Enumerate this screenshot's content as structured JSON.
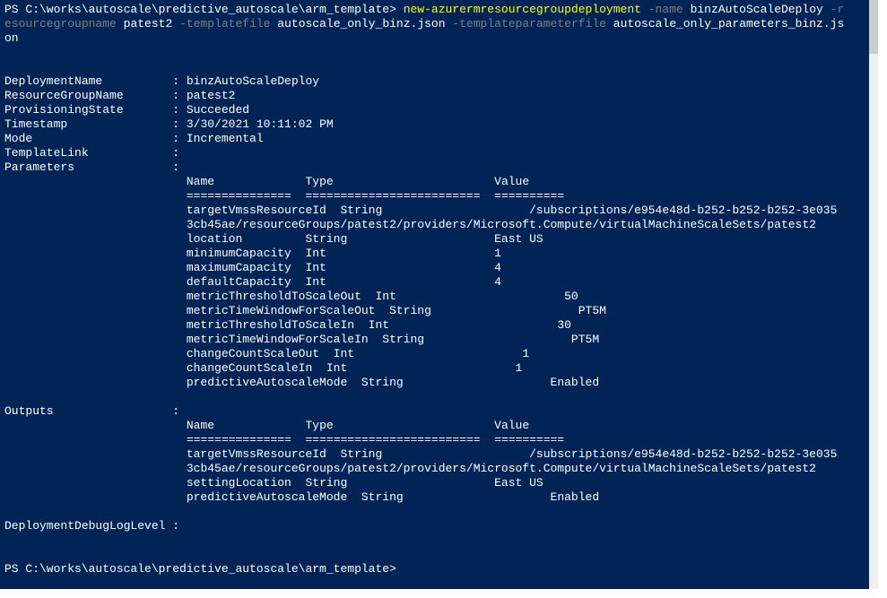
{
  "path": "C:\\works\\autoscale\\predictive_autoscale\\arm_template",
  "cmd": {
    "name": "new-azurermresourcegroupdeployment",
    "p_name": "-name",
    "v_name": "binzAutoScaleDeploy",
    "p_rg": "-r",
    "p_rg2": "esourcegroupname",
    "v_rg": "patest2",
    "p_tf": "-templatefile",
    "v_tf": "autoscale_only_binz.json",
    "p_tpf": "-templateparameterfile",
    "v_tpf": "autoscale_only_parameters_binz.js",
    "v_tpf2": "on"
  },
  "dep": {
    "DeploymentName": "binzAutoScaleDeploy",
    "ResourceGroupName": "patest2",
    "ProvisioningState": "Succeeded",
    "Timestamp": "3/30/2021 10:11:02 PM",
    "Mode": "Incremental",
    "TemplateLink": "",
    "ParametersLabel": "Parameters",
    "OutputsLabel": "Outputs",
    "DebugLabel": "DeploymentDebugLogLevel"
  },
  "hdr": {
    "name": "Name",
    "type": "Type",
    "value": "Value",
    "d1": "===============",
    "d2": "=========================",
    "d3": "=========="
  },
  "params": {
    "targetVmssResourceId": {
      "type": "String",
      "value": "/subscriptions/e954e48d-b252-b252-b252-3e035"
    },
    "targetLine2": "3cb45ae/resourceGroups/patest2/providers/Microsoft.Compute/virtualMachineScaleSets/patest2",
    "location": {
      "type": "String",
      "value": "East US"
    },
    "minimumCapacity": {
      "type": "Int",
      "value": "1"
    },
    "maximumCapacity": {
      "type": "Int",
      "value": "4"
    },
    "defaultCapacity": {
      "type": "Int",
      "value": "4"
    },
    "metricThresholdToScaleOut": {
      "type": "Int",
      "value": "50"
    },
    "metricTimeWindowForScaleOut": {
      "type": "String",
      "value": "PT5M"
    },
    "metricThresholdToScaleIn": {
      "type": "Int",
      "value": "30"
    },
    "metricTimeWindowForScaleIn": {
      "type": "String",
      "value": "PT5M"
    },
    "changeCountScaleOut": {
      "type": "Int",
      "value": "1"
    },
    "changeCountScaleIn": {
      "type": "Int",
      "value": "1"
    },
    "predictiveAutoscaleMode": {
      "type": "String",
      "value": "Enabled"
    }
  },
  "outputs": {
    "targetVmssResourceId": {
      "type": "String",
      "value": "/subscriptions/e954e48d-b252-b252-b252-3e035"
    },
    "targetLine2": "3cb45ae/resourceGroups/patest2/providers/Microsoft.Compute/virtualMachineScaleSets/patest2",
    "settingLocation": {
      "type": "String",
      "value": "East US"
    },
    "predictiveAutoscaleMode": {
      "type": "String",
      "value": "Enabled"
    }
  },
  "chart_data": {
    "type": "table",
    "title": "ARM Deployment Parameters",
    "columns": [
      "Name",
      "Type",
      "Value"
    ],
    "rows": [
      [
        "targetVmssResourceId",
        "String",
        "/subscriptions/e954e48d-b252-b252-b252-3e0353cb45ae/resourceGroups/patest2/providers/Microsoft.Compute/virtualMachineScaleSets/patest2"
      ],
      [
        "location",
        "String",
        "East US"
      ],
      [
        "minimumCapacity",
        "Int",
        1
      ],
      [
        "maximumCapacity",
        "Int",
        4
      ],
      [
        "defaultCapacity",
        "Int",
        4
      ],
      [
        "metricThresholdToScaleOut",
        "Int",
        50
      ],
      [
        "metricTimeWindowForScaleOut",
        "String",
        "PT5M"
      ],
      [
        "metricThresholdToScaleIn",
        "Int",
        30
      ],
      [
        "metricTimeWindowForScaleIn",
        "String",
        "PT5M"
      ],
      [
        "changeCountScaleOut",
        "Int",
        1
      ],
      [
        "changeCountScaleIn",
        "Int",
        1
      ],
      [
        "predictiveAutoscaleMode",
        "String",
        "Enabled"
      ]
    ]
  }
}
